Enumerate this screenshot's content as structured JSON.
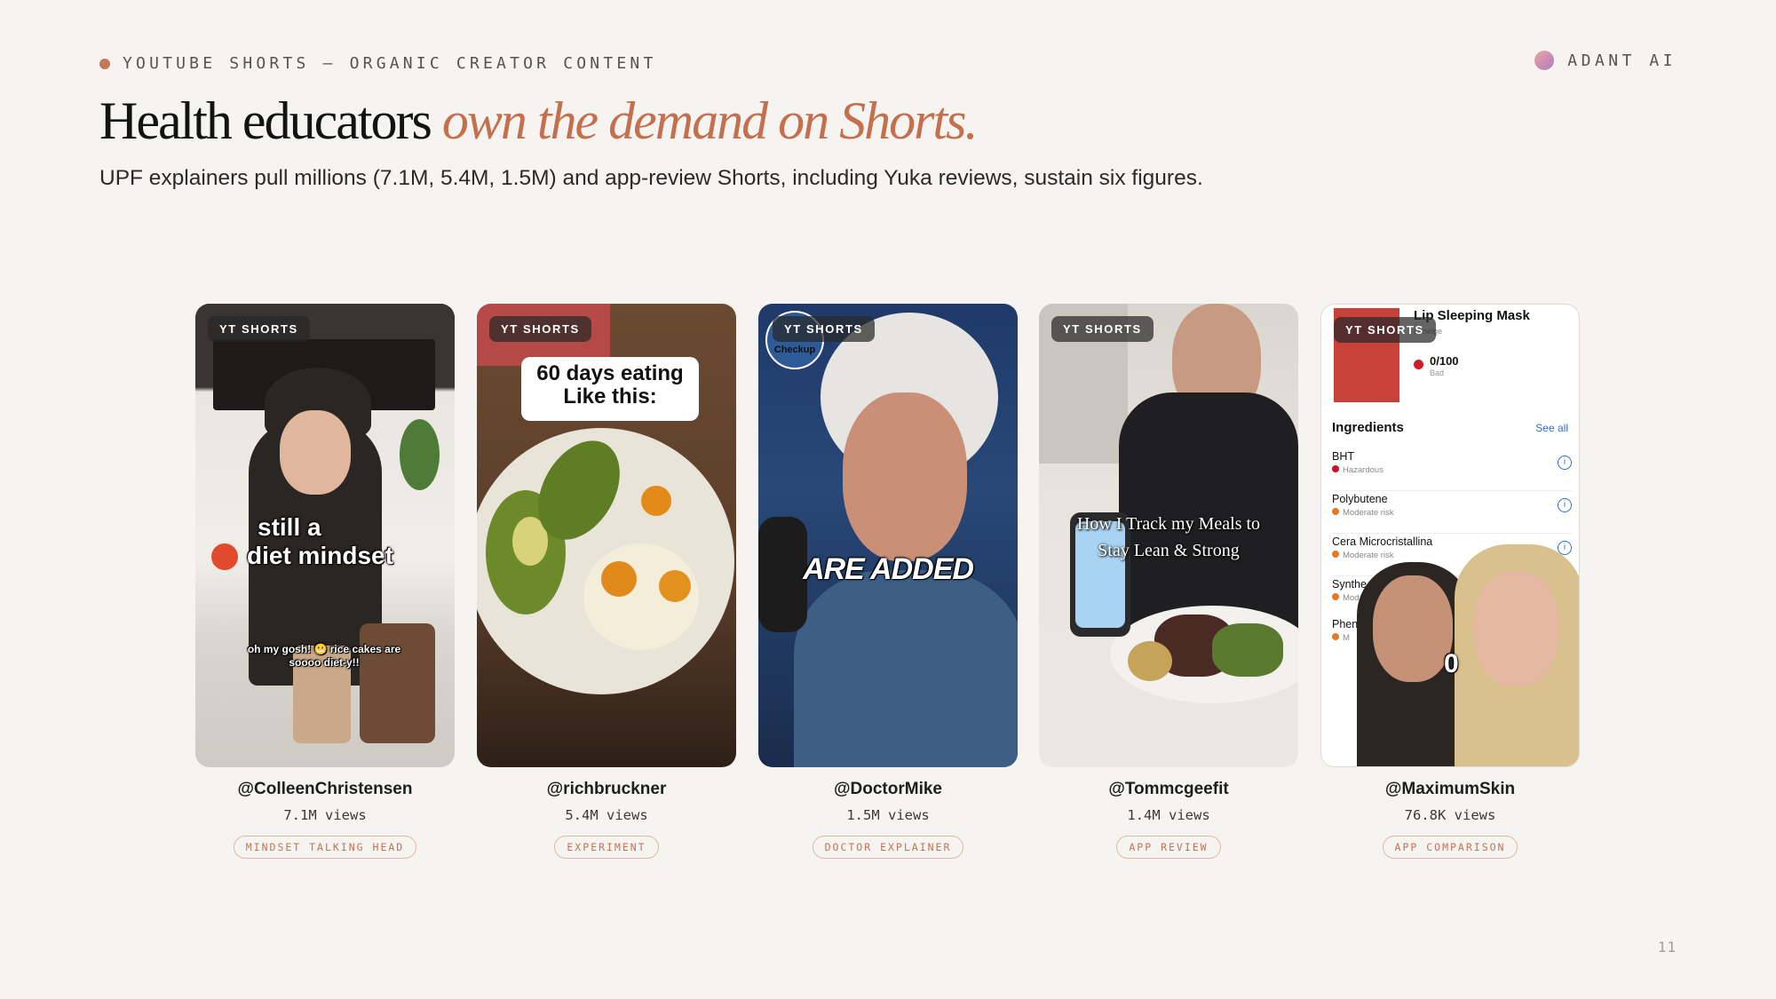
{
  "eyebrow": "YOUTUBE SHORTS — ORGANIC CREATOR CONTENT",
  "brand": "ADANT AI",
  "title": {
    "main": "Health educators",
    "accent": "own the demand on Shorts."
  },
  "subtitle": "UPF explainers pull millions (7.1M, 5.4M, 1.5M) and app-review Shorts, including Yuka reviews, sustain six figures.",
  "page_number": "11",
  "colors": {
    "accent": "#c4704f",
    "background": "#f5f4f1",
    "tag_border": "#e3b9a4"
  },
  "cards": [
    {
      "badge": "YT SHORTS",
      "handle": "@ColleenChristensen",
      "views": "7.1M views",
      "tag": "MINDSET TALKING HEAD",
      "caption_line1": "still a",
      "caption_line2": "diet mindset",
      "subcaption": "oh my gosh! 😬 rice cakes are soooo diet-y!!"
    },
    {
      "badge": "YT SHORTS",
      "handle": "@richbruckner",
      "views": "5.4M views",
      "tag": "EXPERIMENT",
      "caption_line1": "60 days eating",
      "caption_line2": "Like this:"
    },
    {
      "badge": "YT SHORTS",
      "handle": "@DoctorMike",
      "views": "1.5M views",
      "tag": "DOCTOR EXPLAINER",
      "caption": "ARE ADDED",
      "logo_text": "Checkup"
    },
    {
      "badge": "YT SHORTS",
      "handle": "@Tommcgeefit",
      "views": "1.4M views",
      "tag": "APP REVIEW",
      "caption_line1": "How I Track my Meals to",
      "caption_line2": "Stay Lean & Strong"
    },
    {
      "badge": "YT SHORTS",
      "handle": "@MaximumSkin",
      "views": "76.8K views",
      "tag": "APP COMPARISON",
      "product_name": "Lip Sleeping Mask",
      "product_brand": "Laneige",
      "score": "0/100",
      "score_label": "Bad",
      "section_title": "Ingredients",
      "see_all": "See all",
      "ingredients": [
        {
          "name": "BHT",
          "risk": "Hazardous"
        },
        {
          "name": "Polybutene",
          "risk": "Moderate risk"
        },
        {
          "name": "Cera Microcristallina",
          "risk": "Moderate risk"
        },
        {
          "name": "Synthe",
          "risk": "Mod"
        },
        {
          "name": "Phen",
          "risk": "M"
        }
      ],
      "overlay_number": "0"
    }
  ]
}
